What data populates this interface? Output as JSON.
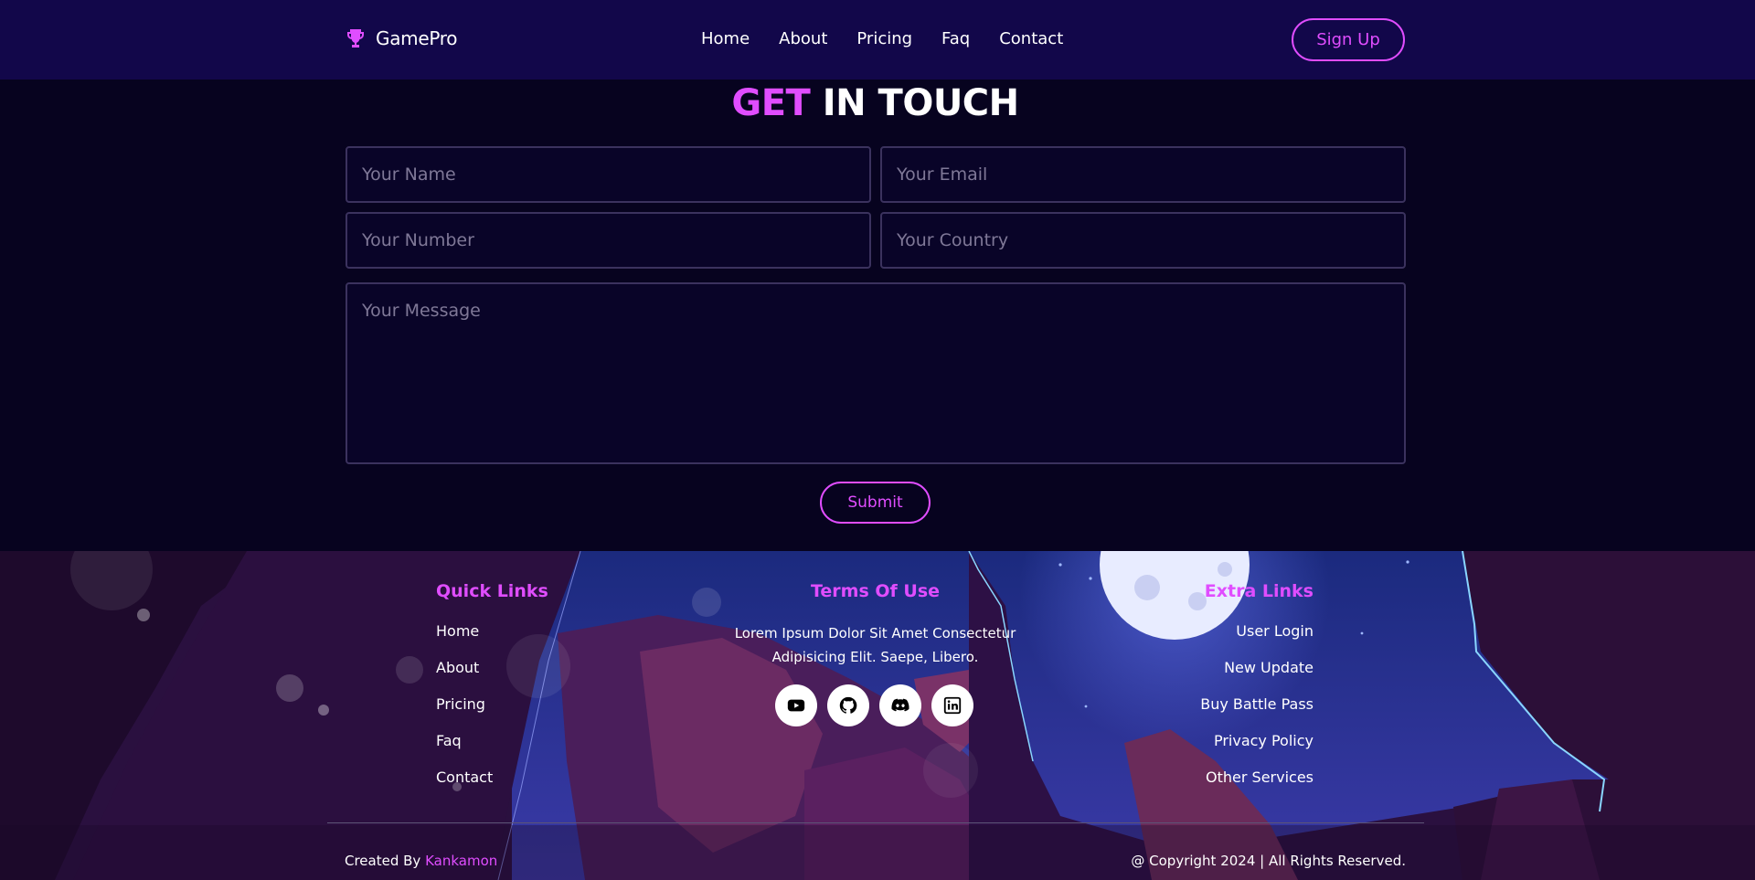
{
  "header": {
    "brand": "GamePro",
    "nav": [
      {
        "label": "Home"
      },
      {
        "label": "About"
      },
      {
        "label": "Pricing"
      },
      {
        "label": "Faq"
      },
      {
        "label": "Contact"
      }
    ],
    "signup_label": "Sign Up"
  },
  "contact": {
    "title_accent": "GET",
    "title_rest": "IN TOUCH",
    "fields": {
      "name_placeholder": "Your Name",
      "email_placeholder": "Your Email",
      "number_placeholder": "Your Number",
      "country_placeholder": "Your Country",
      "message_placeholder": "Your Message"
    },
    "submit_label": "Submit"
  },
  "footer": {
    "quick_links": {
      "title": "Quick Links",
      "items": [
        "Home",
        "About",
        "Pricing",
        "Faq",
        "Contact"
      ]
    },
    "terms": {
      "title": "Terms Of Use",
      "text": "Lorem Ipsum Dolor Sit Amet Consectetur Adipisicing Elit. Saepe, Libero."
    },
    "socials": [
      "youtube-icon",
      "github-icon",
      "discord-icon",
      "linkedin-icon"
    ],
    "extra_links": {
      "title": "Extra Links",
      "items": [
        "User Login",
        "New Update",
        "Buy Battle Pass",
        "Privacy Policy",
        "Other Services"
      ]
    },
    "credit_prefix": "Created By",
    "credit_author": "Kankamon",
    "copyright": "@ Copyright 2024 | All Rights Reserved."
  },
  "colors": {
    "accent": "#e04dff",
    "header_bg": "#12074a",
    "page_bg": "#07031f"
  }
}
